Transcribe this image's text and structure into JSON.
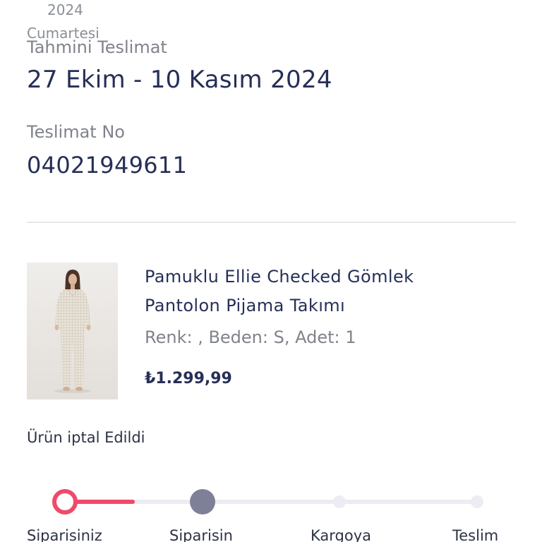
{
  "header": {
    "year": "2024",
    "day": "Cumartesi"
  },
  "estimated_delivery": {
    "label": "Tahmini Teslimat",
    "value": "27 Ekim - 10 Kasım 2024"
  },
  "delivery": {
    "label": "Teslimat No",
    "number": "04021949611"
  },
  "product": {
    "image_icon": "product-photo",
    "title_lines": [
      "Pamuklu Ellie Checked Gömlek",
      "Pantolon Pijama Takımı"
    ],
    "attributes": "Renk: , Beden: S, Adet: 1",
    "price": "₺1.299,99"
  },
  "status_text": "Ürün iptal Edildi",
  "progress": {
    "fill_fraction": 0.17,
    "steps": [
      {
        "label": "Siparisiniz"
      },
      {
        "label": "Siparisin"
      },
      {
        "label": "Kargoya"
      },
      {
        "label": "Teslim"
      }
    ]
  },
  "colors": {
    "text_primary": "#262f57",
    "text_muted": "#80838c",
    "accent": "#ef4a6b",
    "track": "#ececf2",
    "active_step": "#7e8098"
  }
}
